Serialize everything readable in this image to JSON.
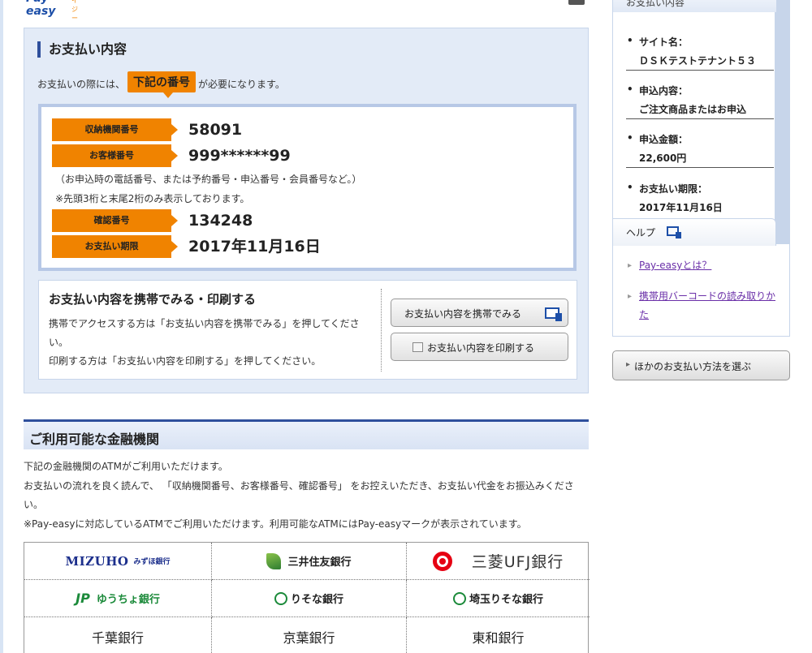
{
  "logo": {
    "text": "Pay-easy",
    "kana": "ペイジー"
  },
  "payment": {
    "title": "お支払い内容",
    "lead_before": "お支払いの際には、",
    "lead_keyword": "下記の番号",
    "lead_after": "が必要になります。",
    "rows": [
      {
        "label": "収納機関番号",
        "value": "58091"
      },
      {
        "label": "お客様番号",
        "value": "999******99"
      },
      {
        "label": "確認番号",
        "value": "134248"
      },
      {
        "label": "お支払い期限",
        "value": "2017年11月16日"
      }
    ],
    "note1": "（お申込時の電話番号、または予約番号・申込番号・会員番号など。）",
    "note2": "※先頭3桁と末尾2桁のみ表示しております。"
  },
  "mobile": {
    "title": "お支払い内容を携帯でみる・印刷する",
    "desc1": "携帯でアクセスする方は「お支払い内容を携帯でみる」を押してください。",
    "desc2": "印刷する方は「お支払い内容を印刷する」を押してください。",
    "btn_mobile": "お支払い内容を携帯でみる",
    "btn_print": "お支払い内容を印刷する"
  },
  "banks": {
    "title": "ご利用可能な金融機関",
    "text1": "下記の金融機関のATMがご利用いただけます。",
    "text2": "お支払いの流れを良く読んで、 「収納機関番号、お客様番号、確認番号」 をお控えいただき、お支払い代金をお振込みください。",
    "text3": "※Pay-easyに対応しているATMでご利用いただけます。利用可能なATMにはPay-easyマークが表示されています。",
    "mizuho": "MIZUHO",
    "mizuho_sub": "みずほ銀行",
    "smbc": "三井住友銀行",
    "mufg": "三菱UFJ銀行",
    "jp_mark": "JP",
    "yucho": "ゆうちょ銀行",
    "resona": "りそな銀行",
    "saitama": "埼玉りそな銀行",
    "chiba": "千葉銀行",
    "keiyo": "京葉銀行",
    "towa": "東和銀行"
  },
  "sidebar": {
    "title": "お支払い内容",
    "items": [
      {
        "label": "サイト名：",
        "value": "ＤＳＫテストテナント５３"
      },
      {
        "label": "申込内容：",
        "value": "ご注文商品またはお申込"
      },
      {
        "label": "申込金額：",
        "value": "22,600円"
      },
      {
        "label": "お支払い期限：",
        "value": "2017年11月16日"
      }
    ],
    "help_title": "ヘルプ",
    "help_links": [
      "Pay-easyとは？",
      "携帯用バーコードの読み取りかた"
    ],
    "other_button": "ほかのお支払い方法を選ぶ"
  }
}
